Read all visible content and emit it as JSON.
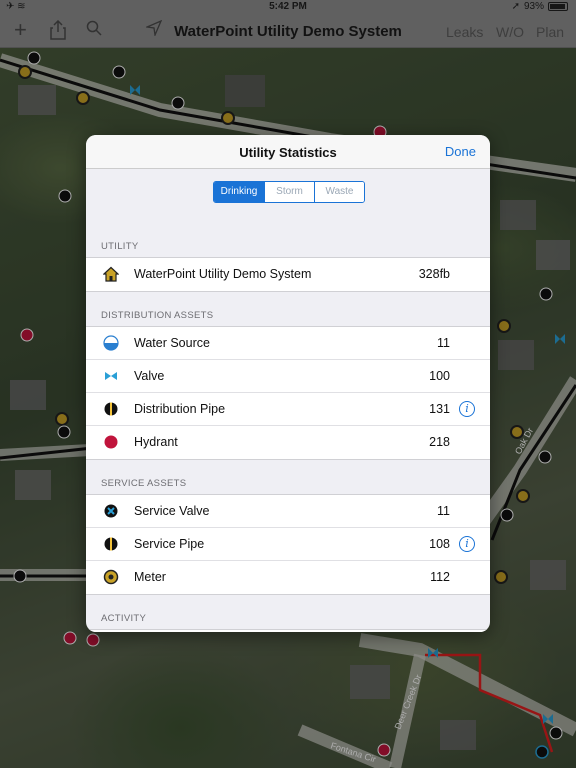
{
  "status_bar": {
    "time": "5:42 PM",
    "battery": "93%"
  },
  "nav_bar": {
    "title": "WaterPoint Utility Demo System",
    "right_items": [
      "Leaks",
      "W/O",
      "Plan"
    ],
    "icons": [
      "add-icon",
      "share-icon",
      "search-icon",
      "location-arrow-icon"
    ]
  },
  "modal": {
    "title": "Utility Statistics",
    "done_label": "Done",
    "segments": [
      {
        "label": "Drinking",
        "active": true
      },
      {
        "label": "Storm",
        "active": false
      },
      {
        "label": "Waste",
        "active": false
      }
    ],
    "sections": [
      {
        "header": "UTILITY",
        "rows": [
          {
            "icon": "house-icon",
            "label": "WaterPoint Utility Demo System",
            "value": "328fb",
            "info": false
          }
        ]
      },
      {
        "header": "DISTRIBUTION ASSETS",
        "rows": [
          {
            "icon": "water-source-icon",
            "label": "Water Source",
            "value": "11",
            "info": false
          },
          {
            "icon": "valve-icon",
            "label": "Valve",
            "value": "100",
            "info": false
          },
          {
            "icon": "distribution-pipe-icon",
            "label": "Distribution Pipe",
            "value": "131",
            "info": true
          },
          {
            "icon": "hydrant-icon",
            "label": "Hydrant",
            "value": "218",
            "info": false
          }
        ]
      },
      {
        "header": "SERVICE ASSETS",
        "rows": [
          {
            "icon": "service-valve-icon",
            "label": "Service Valve",
            "value": "11",
            "info": false
          },
          {
            "icon": "service-pipe-icon",
            "label": "Service Pipe",
            "value": "108",
            "info": true
          },
          {
            "icon": "meter-icon",
            "label": "Meter",
            "value": "112",
            "info": false
          }
        ]
      },
      {
        "header": "ACTIVITY",
        "rows": []
      }
    ]
  },
  "map": {
    "street_labels": [
      "Fontana Cir",
      "Deer Creek Dr",
      "Oak Dr"
    ]
  },
  "colors": {
    "accent": "#1a73d6",
    "hydrant": "#c0143c",
    "meter": "#c9a227",
    "valve": "#2a9fd6",
    "pipe": "#111111",
    "service_line": "#e02020"
  }
}
